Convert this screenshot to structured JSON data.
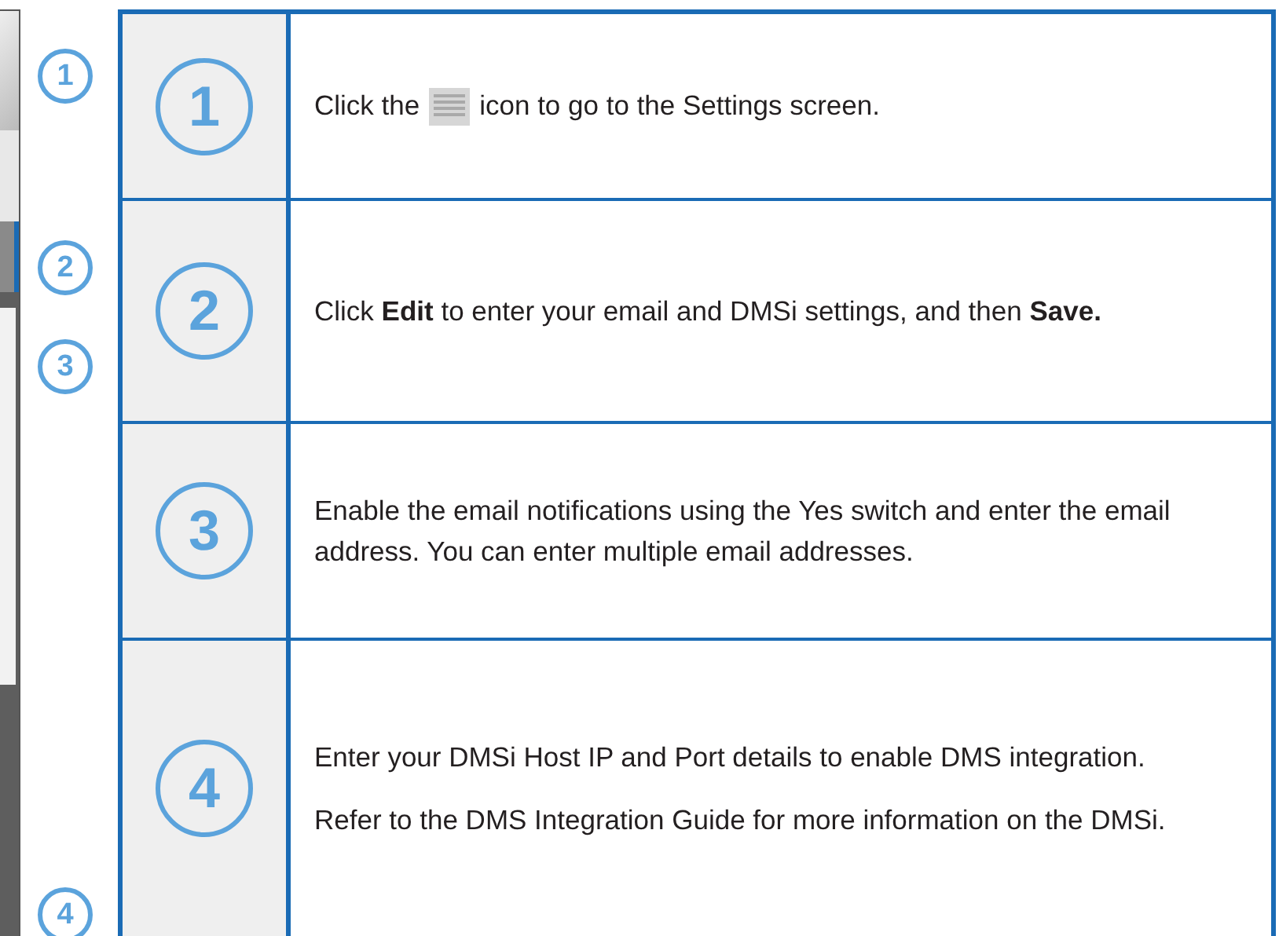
{
  "callouts": [
    "1",
    "2",
    "3",
    "4"
  ],
  "steps": [
    {
      "number": "1",
      "kind": "with_icon",
      "parts": [
        "Click the",
        "icon to go to the Settings screen."
      ]
    },
    {
      "number": "2",
      "kind": "text",
      "paragraphs": [
        "Click **Edit** to enter your email and DMSi settings, and then **Save.**"
      ]
    },
    {
      "number": "3",
      "kind": "text",
      "paragraphs": [
        "Enable the email notifications using the Yes switch and enter the email address. You can enter multiple email addresses."
      ]
    },
    {
      "number": "4",
      "kind": "text",
      "paragraphs": [
        "Enter your DMSi Host IP and Port details to enable DMS integration.",
        "Refer to the DMS Integration Guide for more information on the DMSi."
      ]
    }
  ]
}
